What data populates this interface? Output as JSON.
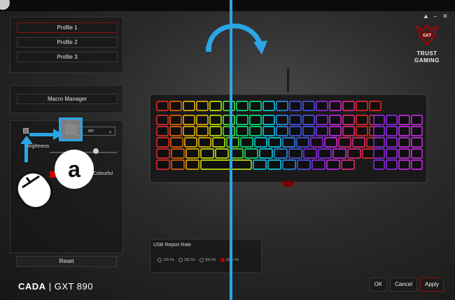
{
  "window": {
    "controls": [
      "▲",
      "–",
      "✕"
    ]
  },
  "left_panel": {
    "profiles": [
      "Profile 1",
      "Profile 2",
      "Profile 3"
    ],
    "macro_manager_label": "Macro Manager",
    "mode_select_value": "on",
    "brightness_label": "Brightness",
    "brightness_level": 0.75,
    "colour_option_label": "Colourful",
    "reset_label": "Reset"
  },
  "brand": {
    "product_name": "CADA",
    "separator": "|",
    "model": "GXT 890",
    "logo_line1": "TRUST",
    "logo_line2": "GAMING",
    "seal_text": "GXT"
  },
  "usb": {
    "title": "USB Report Rate",
    "options": [
      "125 Hz",
      "250 Hz",
      "500 Hz",
      "1000 Hz"
    ],
    "selected": "1000 Hz"
  },
  "footer": {
    "ok_label": "OK",
    "cancel_label": "Cancel",
    "apply_label": "Apply"
  },
  "annotation": {
    "badge_glyph": "a"
  },
  "colors": {
    "accent_red": "#c40000",
    "annotation_blue": "#2aa6e6"
  }
}
